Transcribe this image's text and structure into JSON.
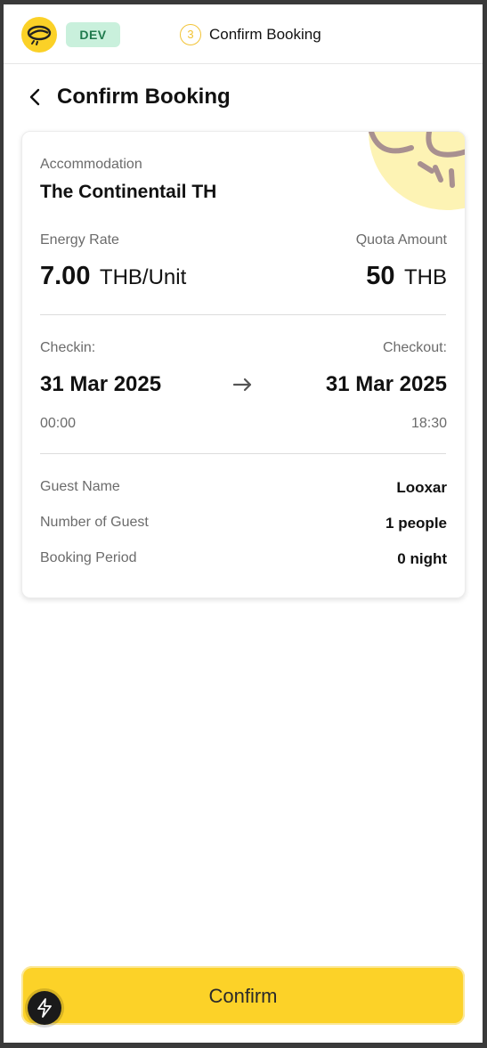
{
  "header": {
    "env_badge": "DEV",
    "step_number": "3",
    "step_label": "Confirm Booking"
  },
  "page": {
    "title": "Confirm Booking"
  },
  "booking": {
    "accommodation_label": "Accommodation",
    "accommodation_name": "The Continentail TH",
    "energy_rate_label": "Energy Rate",
    "energy_rate_value": "7.00",
    "energy_rate_unit": "THB/Unit",
    "quota_label": "Quota Amount",
    "quota_value": "50",
    "quota_unit": "THB",
    "checkin_label": "Checkin:",
    "checkin_date": "31 Mar 2025",
    "checkin_time": "00:00",
    "checkout_label": "Checkout:",
    "checkout_date": "31 Mar 2025",
    "checkout_time": "18:30",
    "guest_name_label": "Guest Name",
    "guest_name_value": "Looxar",
    "guest_count_label": "Number of Guest",
    "guest_count_value": "1 people",
    "period_label": "Booking Period",
    "period_value": "0 night"
  },
  "actions": {
    "confirm_label": "Confirm"
  },
  "icons": {
    "logo": "brand-logo-icon",
    "back": "chevron-left-icon",
    "arrow": "arrow-right-icon",
    "fab": "lightning-bolt-icon",
    "decoration": "sun-icon"
  },
  "colors": {
    "accent": "#fcd228",
    "badge_bg": "#c9f0dc",
    "badge_text": "#1f7a4d"
  }
}
